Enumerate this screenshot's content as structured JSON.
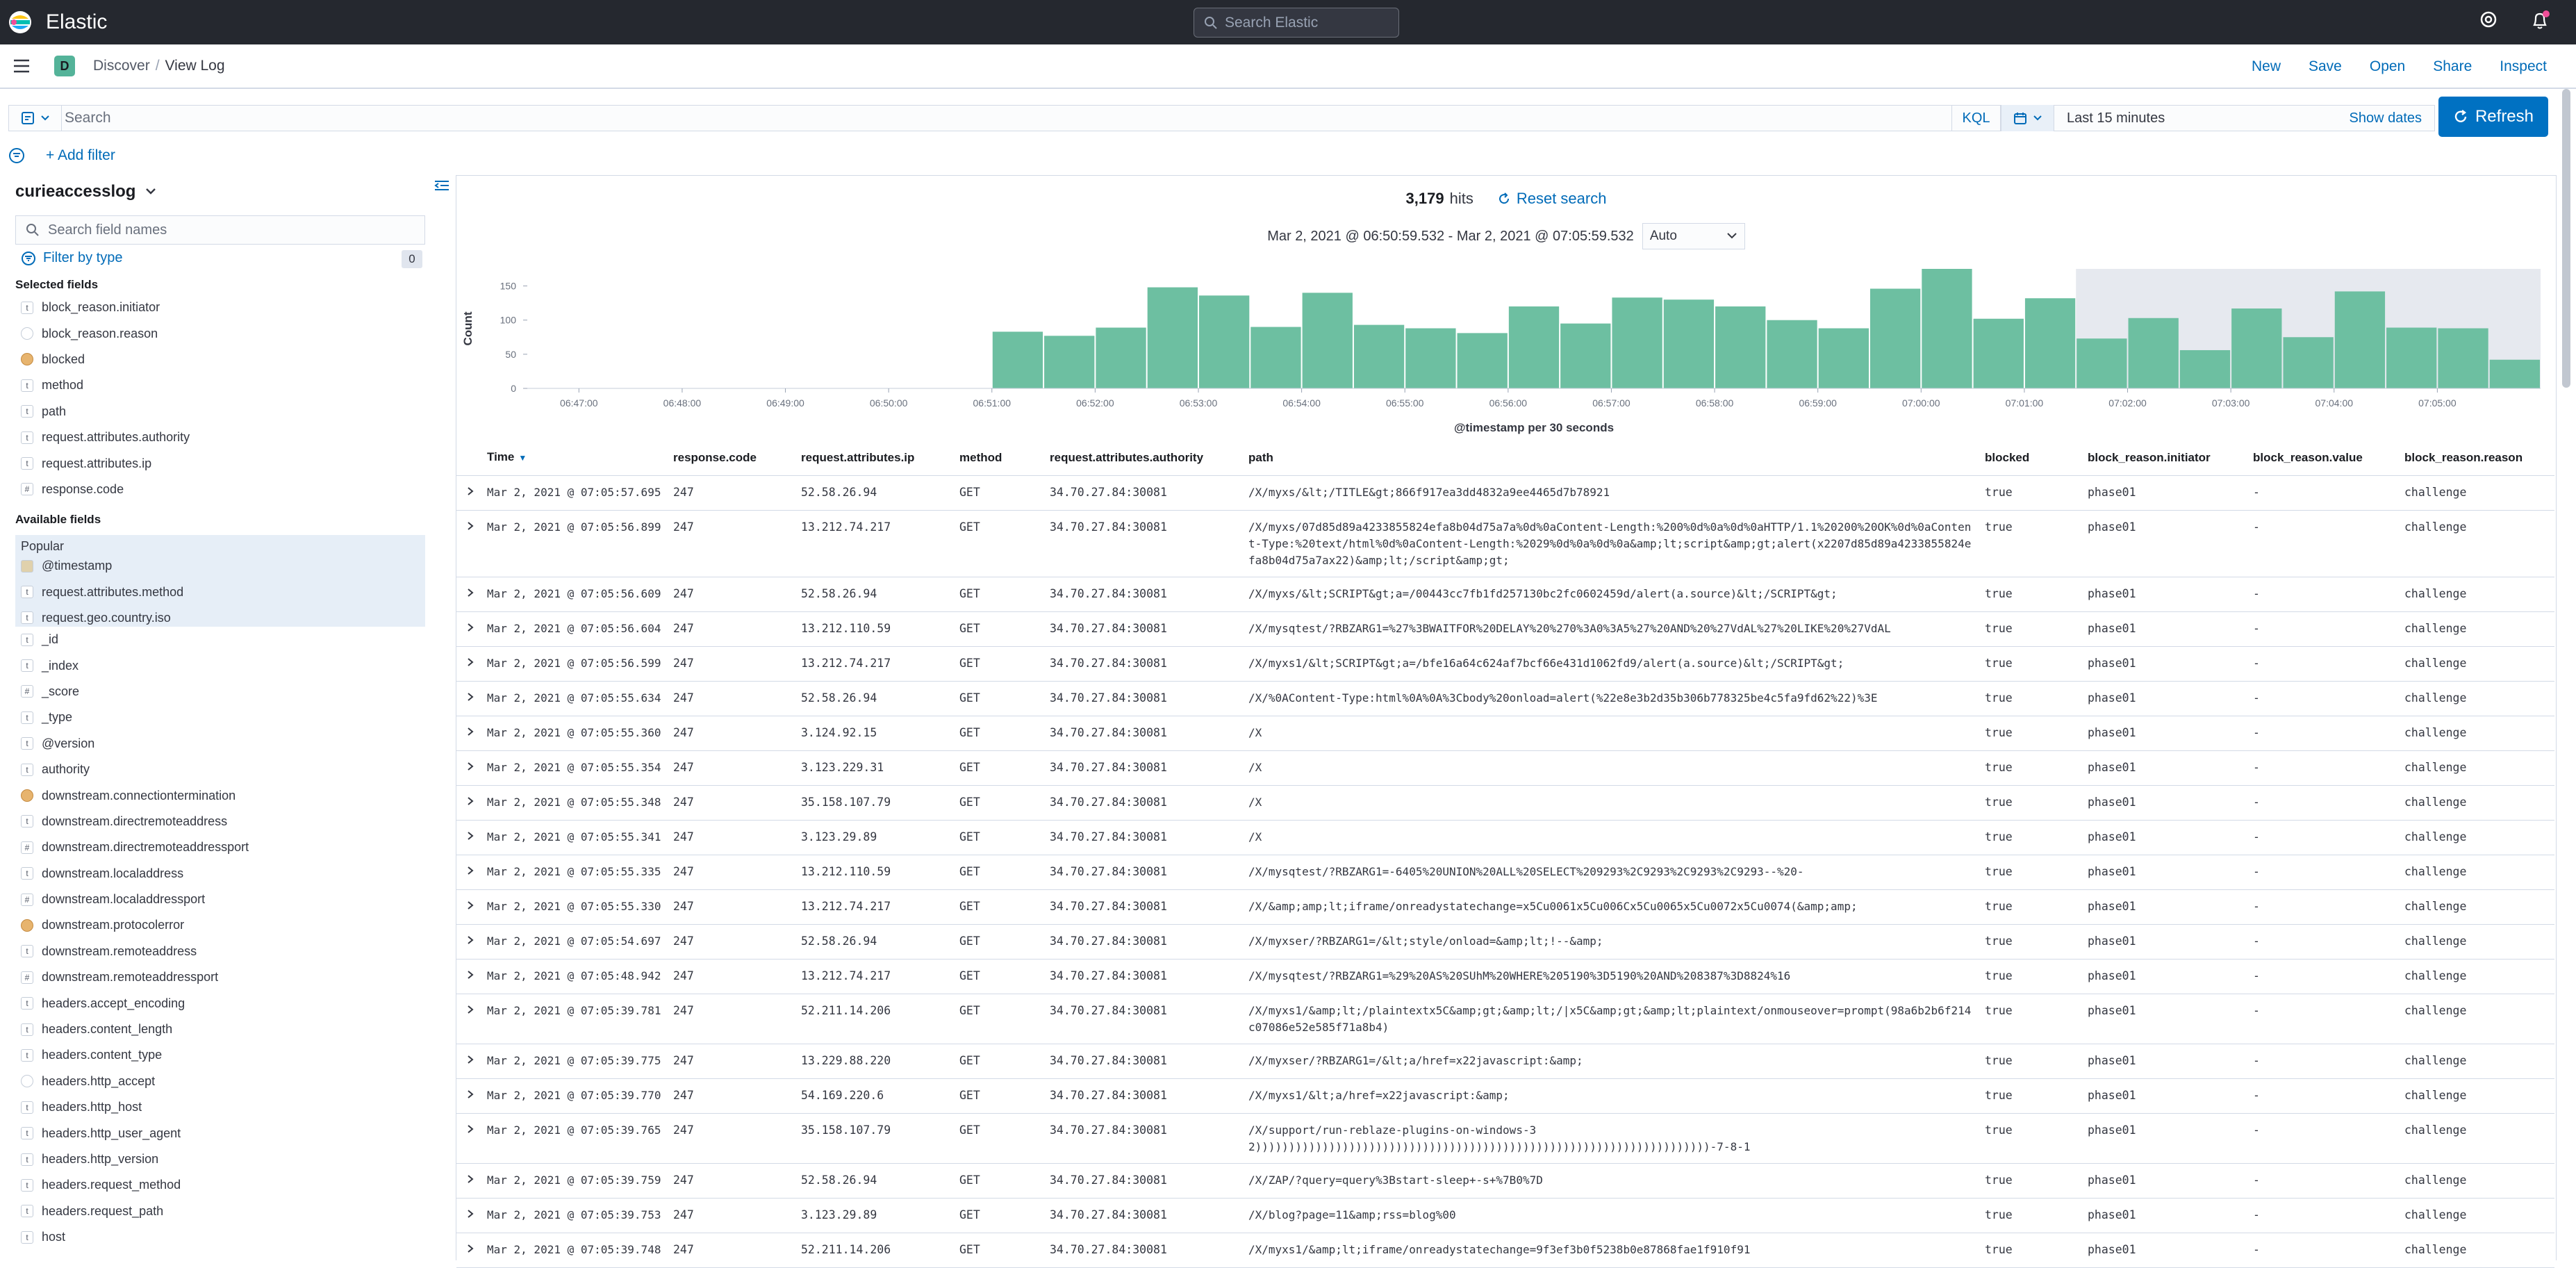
{
  "app": {
    "brand": "Elastic",
    "global_search_placeholder": "Search Elastic"
  },
  "header": {
    "space_initial": "D",
    "breadcrumb": [
      "Discover",
      "View Log"
    ],
    "nav": [
      "New",
      "Save",
      "Open",
      "Share",
      "Inspect"
    ]
  },
  "query": {
    "placeholder": "Search",
    "language": "KQL",
    "time_range": "Last 15 minutes",
    "show_dates": "Show dates",
    "refresh": "Refresh"
  },
  "filters": {
    "add_filter": "+ Add filter"
  },
  "sidebar": {
    "index_pattern": "curieaccesslog",
    "field_search_placeholder": "Search field names",
    "filter_by_type": "Filter by type",
    "filter_count": "0",
    "selected_title": "Selected fields",
    "selected": [
      {
        "type": "t",
        "name": "block_reason.initiator"
      },
      {
        "type": "ip",
        "name": "block_reason.reason"
      },
      {
        "type": "bool",
        "name": "blocked"
      },
      {
        "type": "t",
        "name": "method"
      },
      {
        "type": "t",
        "name": "path"
      },
      {
        "type": "t",
        "name": "request.attributes.authority"
      },
      {
        "type": "t",
        "name": "request.attributes.ip"
      },
      {
        "type": "#",
        "name": "response.code"
      }
    ],
    "available_title": "Available fields",
    "popular_title": "Popular",
    "popular": [
      {
        "type": "date",
        "name": "@timestamp"
      },
      {
        "type": "t",
        "name": "request.attributes.method"
      },
      {
        "type": "t",
        "name": "request.geo.country.iso"
      }
    ],
    "available": [
      {
        "type": "t",
        "name": "_id"
      },
      {
        "type": "t",
        "name": "_index"
      },
      {
        "type": "#",
        "name": "_score"
      },
      {
        "type": "t",
        "name": "_type"
      },
      {
        "type": "t",
        "name": "@version"
      },
      {
        "type": "t",
        "name": "authority"
      },
      {
        "type": "bool",
        "name": "downstream.connectiontermination"
      },
      {
        "type": "t",
        "name": "downstream.directremoteaddress"
      },
      {
        "type": "#",
        "name": "downstream.directremoteaddressport"
      },
      {
        "type": "t",
        "name": "downstream.localaddress"
      },
      {
        "type": "#",
        "name": "downstream.localaddressport"
      },
      {
        "type": "bool",
        "name": "downstream.protocolerror"
      },
      {
        "type": "t",
        "name": "downstream.remoteaddress"
      },
      {
        "type": "#",
        "name": "downstream.remoteaddressport"
      },
      {
        "type": "t",
        "name": "headers.accept_encoding"
      },
      {
        "type": "t",
        "name": "headers.content_length"
      },
      {
        "type": "t",
        "name": "headers.content_type"
      },
      {
        "type": "ip",
        "name": "headers.http_accept"
      },
      {
        "type": "t",
        "name": "headers.http_host"
      },
      {
        "type": "t",
        "name": "headers.http_user_agent"
      },
      {
        "type": "t",
        "name": "headers.http_version"
      },
      {
        "type": "t",
        "name": "headers.request_method"
      },
      {
        "type": "t",
        "name": "headers.request_path"
      },
      {
        "type": "t",
        "name": "host"
      }
    ]
  },
  "results": {
    "hits": "3,179",
    "hits_label": "hits",
    "reset": "Reset search",
    "range": "Mar 2, 2021 @ 06:50:59.532 - Mar 2, 2021 @ 07:05:59.532",
    "interval": "Auto"
  },
  "chart_data": {
    "type": "bar",
    "xlabel": "@timestamp per 30 seconds",
    "ylabel": "Count",
    "ylim": [
      0,
      175
    ],
    "yticks": [
      0,
      50,
      100,
      150
    ],
    "x_ticks": [
      "06:47:00",
      "06:48:00",
      "06:49:00",
      "06:50:00",
      "06:51:00",
      "06:52:00",
      "06:53:00",
      "06:54:00",
      "06:55:00",
      "06:56:00",
      "06:57:00",
      "06:58:00",
      "06:59:00",
      "07:00:00",
      "07:01:00",
      "07:02:00",
      "07:03:00",
      "07:04:00",
      "07:05:00"
    ],
    "x_start": "06:46:30",
    "interval_seconds": 30,
    "bar_start": "06:51:00",
    "values": [
      83,
      77,
      89,
      148,
      136,
      90,
      140,
      93,
      88,
      81,
      120,
      95,
      133,
      130,
      120,
      100,
      88,
      146,
      175,
      102,
      132,
      73,
      103,
      56,
      117,
      75,
      142,
      89,
      88,
      42
    ],
    "selection_start": "07:01:30",
    "color": "#6dbfa1"
  },
  "table": {
    "columns": [
      "Time",
      "response.code",
      "request.attributes.ip",
      "method",
      "request.attributes.authority",
      "path",
      "blocked",
      "block_reason.initiator",
      "block_reason.value",
      "block_reason.reason"
    ],
    "rows": [
      [
        "Mar 2, 2021 @ 07:05:57.695",
        "247",
        "52.58.26.94",
        "GET",
        "34.70.27.84:30081",
        "/X/myxs/&lt;/TITLE&gt;866f917ea3dd4832a9ee4465d7b78921",
        "true",
        "phase01",
        "-",
        "challenge"
      ],
      [
        "Mar 2, 2021 @ 07:05:56.899",
        "247",
        "13.212.74.217",
        "GET",
        "34.70.27.84:30081",
        "/X/myxs/07d85d89a4233855824efa8b04d75a7a%0d%0aContent-Length:%200%0d%0a%0d%0aHTTP/1.1%20200%20OK%0d%0aContent-Type:%20text/html%0d%0aContent-Length:%2029%0d%0a%0d%0a&amp;lt;script&amp;gt;alert(x2207d85d89a4233855824efa8b04d75a7ax22)&amp;lt;/script&amp;gt;",
        "true",
        "phase01",
        "-",
        "challenge"
      ],
      [
        "Mar 2, 2021 @ 07:05:56.609",
        "247",
        "52.58.26.94",
        "GET",
        "34.70.27.84:30081",
        "/X/myxs/&lt;SCRIPT&gt;a=/00443cc7fb1fd257130bc2fc0602459d/alert(a.source)&lt;/SCRIPT&gt;",
        "true",
        "phase01",
        "-",
        "challenge"
      ],
      [
        "Mar 2, 2021 @ 07:05:56.604",
        "247",
        "13.212.110.59",
        "GET",
        "34.70.27.84:30081",
        "/X/mysqtest/?RBZARG1=%27%3BWAITFOR%20DELAY%20%270%3A0%3A5%27%20AND%20%27VdAL%27%20LIKE%20%27VdAL",
        "true",
        "phase01",
        "-",
        "challenge"
      ],
      [
        "Mar 2, 2021 @ 07:05:56.599",
        "247",
        "13.212.74.217",
        "GET",
        "34.70.27.84:30081",
        "/X/myxs1/&lt;SCRIPT&gt;a=/bfe16a64c624af7bcf66e431d1062fd9/alert(a.source)&lt;/SCRIPT&gt;",
        "true",
        "phase01",
        "-",
        "challenge"
      ],
      [
        "Mar 2, 2021 @ 07:05:55.634",
        "247",
        "52.58.26.94",
        "GET",
        "34.70.27.84:30081",
        "/X/%0AContent-Type:html%0A%0A%3Cbody%20onload=alert(%22e8e3b2d35b306b778325be4c5fa9fd62%22)%3E",
        "true",
        "phase01",
        "-",
        "challenge"
      ],
      [
        "Mar 2, 2021 @ 07:05:55.360",
        "247",
        "3.124.92.15",
        "GET",
        "34.70.27.84:30081",
        "/X",
        "true",
        "phase01",
        "-",
        "challenge"
      ],
      [
        "Mar 2, 2021 @ 07:05:55.354",
        "247",
        "3.123.229.31",
        "GET",
        "34.70.27.84:30081",
        "/X",
        "true",
        "phase01",
        "-",
        "challenge"
      ],
      [
        "Mar 2, 2021 @ 07:05:55.348",
        "247",
        "35.158.107.79",
        "GET",
        "34.70.27.84:30081",
        "/X",
        "true",
        "phase01",
        "-",
        "challenge"
      ],
      [
        "Mar 2, 2021 @ 07:05:55.341",
        "247",
        "3.123.29.89",
        "GET",
        "34.70.27.84:30081",
        "/X",
        "true",
        "phase01",
        "-",
        "challenge"
      ],
      [
        "Mar 2, 2021 @ 07:05:55.335",
        "247",
        "13.212.110.59",
        "GET",
        "34.70.27.84:30081",
        "/X/mysqtest/?RBZARG1=-6405%20UNION%20ALL%20SELECT%209293%2C9293%2C9293%2C9293--%20-",
        "true",
        "phase01",
        "-",
        "challenge"
      ],
      [
        "Mar 2, 2021 @ 07:05:55.330",
        "247",
        "13.212.74.217",
        "GET",
        "34.70.27.84:30081",
        "/X/&amp;amp;lt;iframe/onreadystatechange=x5Cu0061x5Cu006Cx5Cu0065x5Cu0072x5Cu0074(&amp;amp;",
        "true",
        "phase01",
        "-",
        "challenge"
      ],
      [
        "Mar 2, 2021 @ 07:05:54.697",
        "247",
        "52.58.26.94",
        "GET",
        "34.70.27.84:30081",
        "/X/myxser/?RBZARG1=/&lt;style/onload=&amp;lt;!--&amp;",
        "true",
        "phase01",
        "-",
        "challenge"
      ],
      [
        "Mar 2, 2021 @ 07:05:48.942",
        "247",
        "13.212.74.217",
        "GET",
        "34.70.27.84:30081",
        "/X/mysqtest/?RBZARG1=%29%20AS%20SUhM%20WHERE%205190%3D5190%20AND%208387%3D8824%16",
        "true",
        "phase01",
        "-",
        "challenge"
      ],
      [
        "Mar 2, 2021 @ 07:05:39.781",
        "247",
        "52.211.14.206",
        "GET",
        "34.70.27.84:30081",
        "/X/myxs1/&amp;lt;/plaintextx5C&amp;gt;&amp;lt;/|x5C&amp;gt;&amp;lt;plaintext/onmouseover=prompt(98a6b2b6f214c07086e52e585f71a8b4)",
        "true",
        "phase01",
        "-",
        "challenge"
      ],
      [
        "Mar 2, 2021 @ 07:05:39.775",
        "247",
        "13.229.88.220",
        "GET",
        "34.70.27.84:30081",
        "/X/myxser/?RBZARG1=/&lt;a/href=x22javascript:&amp;",
        "true",
        "phase01",
        "-",
        "challenge"
      ],
      [
        "Mar 2, 2021 @ 07:05:39.770",
        "247",
        "54.169.220.6",
        "GET",
        "34.70.27.84:30081",
        "/X/myxs1/&lt;a/href=x22javascript:&amp;",
        "true",
        "phase01",
        "-",
        "challenge"
      ],
      [
        "Mar 2, 2021 @ 07:05:39.765",
        "247",
        "35.158.107.79",
        "GET",
        "34.70.27.84:30081",
        "/X/support/run-reblaze-plugins-on-windows-3 2))))))))))))))))))))))))))))))))))))))))))))))))))))))))))))))))))))-7-8-1",
        "true",
        "phase01",
        "-",
        "challenge"
      ],
      [
        "Mar 2, 2021 @ 07:05:39.759",
        "247",
        "52.58.26.94",
        "GET",
        "34.70.27.84:30081",
        "/X/ZAP/?query=query%3Bstart-sleep+-s+%7B0%7D",
        "true",
        "phase01",
        "-",
        "challenge"
      ],
      [
        "Mar 2, 2021 @ 07:05:39.753",
        "247",
        "3.123.29.89",
        "GET",
        "34.70.27.84:30081",
        "/X/blog?page=11&amp;rss=blog%00",
        "true",
        "phase01",
        "-",
        "challenge"
      ],
      [
        "Mar 2, 2021 @ 07:05:39.748",
        "247",
        "52.211.14.206",
        "GET",
        "34.70.27.84:30081",
        "/X/myxs1/&amp;lt;iframe/onreadystatechange=9f3ef3b0f5238b0e87868fae1f910f91",
        "true",
        "phase01",
        "-",
        "challenge"
      ]
    ]
  }
}
